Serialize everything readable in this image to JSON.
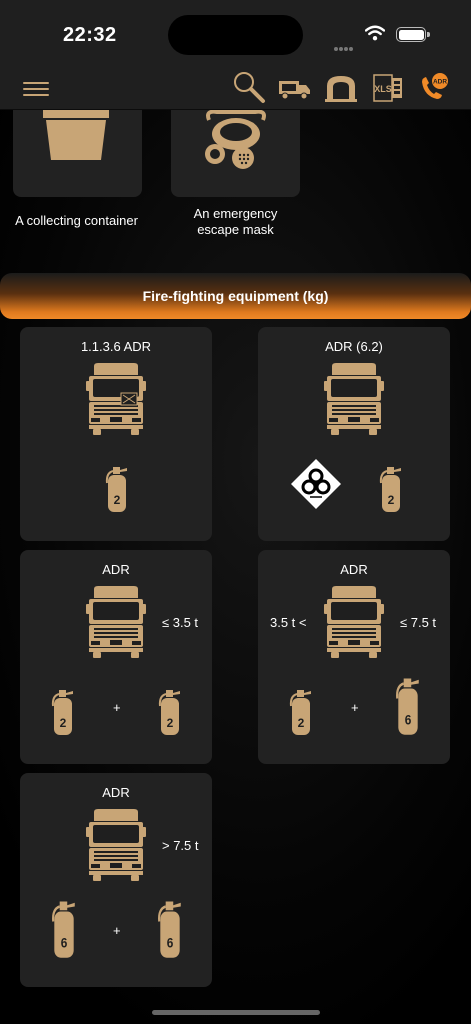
{
  "status_bar": {
    "time": "22:32"
  },
  "nav": {
    "icons": [
      "menu-icon",
      "search-icon",
      "truck-icon",
      "tunnel-icon",
      "xls-icon",
      "adr-phone-icon"
    ],
    "adr_badge": "ADR",
    "xls_label": "XLS"
  },
  "top_items": [
    {
      "label": "A collecting container",
      "icon": "container-icon"
    },
    {
      "label": "An emergency escape mask",
      "icon": "mask-icon"
    }
  ],
  "section": {
    "title": "Fire-fighting equipment (kg)"
  },
  "cards": [
    {
      "title": "1.1.3.6 ADR",
      "extinguishers": [
        "2"
      ]
    },
    {
      "title": "ADR (6.2)",
      "extinguishers": [
        "2"
      ],
      "hazard": "biohazard-icon"
    },
    {
      "title": "ADR",
      "weight": "≤ 3.5 t",
      "extinguishers": [
        "2",
        "2"
      ],
      "plus": "+"
    },
    {
      "title": "ADR",
      "weight_left": "3.5 t <",
      "weight": "≤ 7.5 t",
      "extinguishers": [
        "2",
        "6"
      ],
      "plus": "+"
    },
    {
      "title": "ADR",
      "weight": "> 7.5 t",
      "extinguishers": [
        "6",
        "6"
      ],
      "plus": "+"
    }
  ],
  "colors": {
    "accent": "#c8a576",
    "orange": "#f08a28",
    "card_bg": "#222222"
  }
}
